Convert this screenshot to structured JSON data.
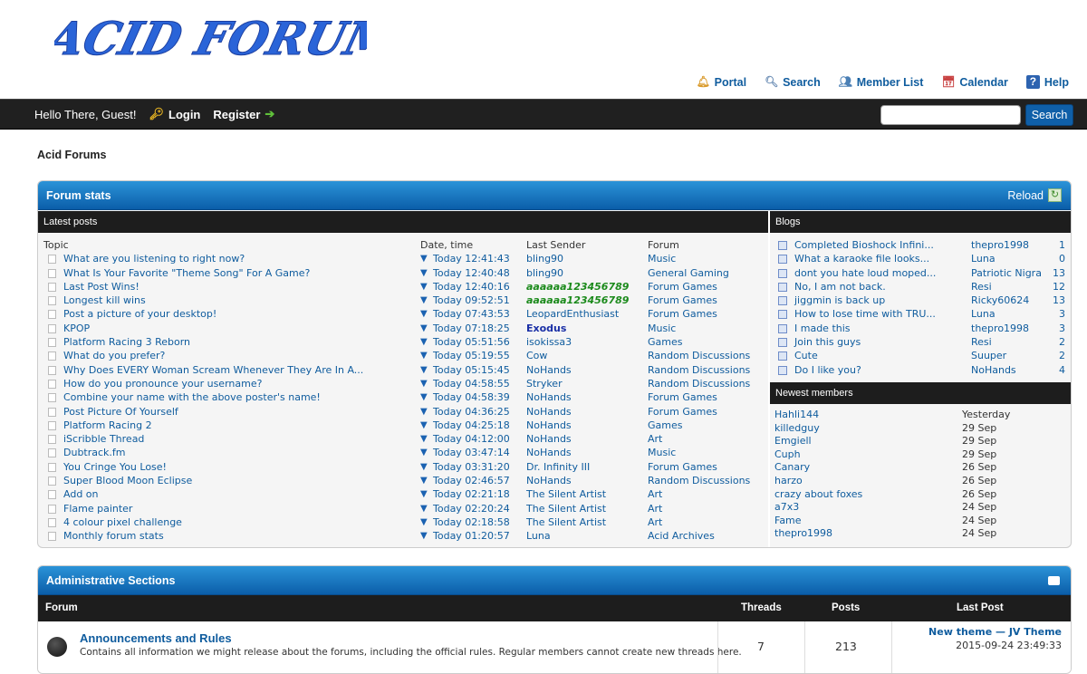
{
  "site": {
    "logo_text": "ACID FORUMS"
  },
  "toplinks": [
    {
      "label": "Portal",
      "icon": "bell-icon"
    },
    {
      "label": "Search",
      "icon": "search-icon"
    },
    {
      "label": "Member List",
      "icon": "members-icon"
    },
    {
      "label": "Calendar",
      "icon": "calendar-icon"
    },
    {
      "label": "Help",
      "icon": "help-icon"
    }
  ],
  "panel": {
    "greeting": "Hello There, Guest!",
    "login": "Login",
    "register": "Register",
    "search_button": "Search",
    "search_value": ""
  },
  "breadcrumb": "Acid Forums",
  "stats": {
    "title": "Forum stats",
    "reload": "Reload",
    "latest_title": "Latest posts",
    "cols": {
      "topic": "Topic",
      "date": "Date, time",
      "sender": "Last Sender",
      "forum": "Forum"
    },
    "posts": [
      {
        "t": "What are you listening to right now?",
        "d": "Today 12:41:43",
        "s": "bling90",
        "f": "Music"
      },
      {
        "t": "What Is Your Favorite \"Theme Song\" For A Game?",
        "d": "Today 12:40:48",
        "s": "bling90",
        "f": "General Gaming"
      },
      {
        "t": "Last Post Wins!",
        "d": "Today 12:40:16",
        "s": "aaaaaa123456789",
        "f": "Forum Games",
        "st": "green"
      },
      {
        "t": "Longest kill wins",
        "d": "Today 09:52:51",
        "s": "aaaaaa123456789",
        "f": "Forum Games",
        "st": "green"
      },
      {
        "t": "Post a picture of your desktop!",
        "d": "Today 07:43:53",
        "s": "LeopardEnthusiast",
        "f": "Forum Games"
      },
      {
        "t": "KPOP",
        "d": "Today 07:18:25",
        "s": "Exodus",
        "f": "Music",
        "st": "navy"
      },
      {
        "t": "Platform Racing 3 Reborn",
        "d": "Today 05:51:56",
        "s": "isokissa3",
        "f": "Games"
      },
      {
        "t": "What do you prefer?",
        "d": "Today 05:19:55",
        "s": "Cow",
        "f": "Random Discussions"
      },
      {
        "t": "Why Does EVERY Woman Scream Whenever They Are In A...",
        "d": "Today 05:15:45",
        "s": "NoHands",
        "f": "Random Discussions"
      },
      {
        "t": "How do you pronounce your username?",
        "d": "Today 04:58:55",
        "s": "Stryker",
        "f": "Random Discussions"
      },
      {
        "t": "Combine your name with the above poster's name!",
        "d": "Today 04:58:39",
        "s": "NoHands",
        "f": "Forum Games"
      },
      {
        "t": "Post Picture Of Yourself",
        "d": "Today 04:36:25",
        "s": "NoHands",
        "f": "Forum Games"
      },
      {
        "t": "Platform Racing 2",
        "d": "Today 04:25:18",
        "s": "NoHands",
        "f": "Games"
      },
      {
        "t": "iScribble Thread",
        "d": "Today 04:12:00",
        "s": "NoHands",
        "f": "Art"
      },
      {
        "t": "Dubtrack.fm",
        "d": "Today 03:47:14",
        "s": "NoHands",
        "f": "Music"
      },
      {
        "t": "You Cringe You Lose!",
        "d": "Today 03:31:20",
        "s": "Dr. Infinity III",
        "f": "Forum Games"
      },
      {
        "t": "Super Blood Moon Eclipse",
        "d": "Today 02:46:57",
        "s": "NoHands",
        "f": "Random Discussions"
      },
      {
        "t": "Add on",
        "d": "Today 02:21:18",
        "s": "The Silent Artist",
        "f": "Art"
      },
      {
        "t": "Flame painter",
        "d": "Today 02:20:24",
        "s": "The Silent Artist",
        "f": "Art"
      },
      {
        "t": "4 colour pixel challenge",
        "d": "Today 02:18:58",
        "s": "The Silent Artist",
        "f": "Art"
      },
      {
        "t": "Monthly forum stats",
        "d": "Today 01:20:57",
        "s": "Luna",
        "f": "Acid Archives"
      }
    ],
    "blogs_title": "Blogs",
    "blogs": [
      {
        "t": "Completed Bioshock Infini...",
        "u": "thepro1998",
        "n": "1"
      },
      {
        "t": "What a karaoke file looks...",
        "u": "Luna",
        "n": "0"
      },
      {
        "t": "dont you hate loud moped...",
        "u": "Patriotic Nigra",
        "n": "13"
      },
      {
        "t": "No, I am not back.",
        "u": "Resi",
        "n": "12"
      },
      {
        "t": "jiggmin is back up",
        "u": "Ricky60624",
        "n": "13"
      },
      {
        "t": "How to lose time with TRU...",
        "u": "Luna",
        "n": "3"
      },
      {
        "t": "I made this",
        "u": "thepro1998",
        "n": "3"
      },
      {
        "t": "Join this guys",
        "u": "Resi",
        "n": "2"
      },
      {
        "t": "Cute",
        "u": "Suuper",
        "n": "2"
      },
      {
        "t": "Do I like you?",
        "u": "NoHands",
        "n": "4"
      }
    ],
    "members_title": "Newest members",
    "members": [
      {
        "u": "Hahli144",
        "d": "Yesterday"
      },
      {
        "u": "killedguy",
        "d": "29 Sep"
      },
      {
        "u": "Emgiell",
        "d": "29 Sep"
      },
      {
        "u": "Cuph",
        "d": "29 Sep"
      },
      {
        "u": "Canary",
        "d": "26 Sep"
      },
      {
        "u": "harzo",
        "d": "26 Sep"
      },
      {
        "u": "crazy about foxes",
        "d": "26 Sep"
      },
      {
        "u": "a7x3",
        "d": "24 Sep"
      },
      {
        "u": "Fame",
        "d": "24 Sep"
      },
      {
        "u": "thepro1998",
        "d": "24 Sep"
      }
    ]
  },
  "admin": {
    "title": "Administrative Sections",
    "cols": {
      "forum": "Forum",
      "threads": "Threads",
      "posts": "Posts",
      "last": "Last Post"
    },
    "row": {
      "name": "Announcements and Rules",
      "desc": "Contains all information we might release about the forums, including the official rules. Regular members cannot create new threads here.",
      "threads": "7",
      "posts": "213",
      "last_title": "New theme — JV Theme",
      "last_date": "2015-09-24 23:49:33"
    }
  }
}
